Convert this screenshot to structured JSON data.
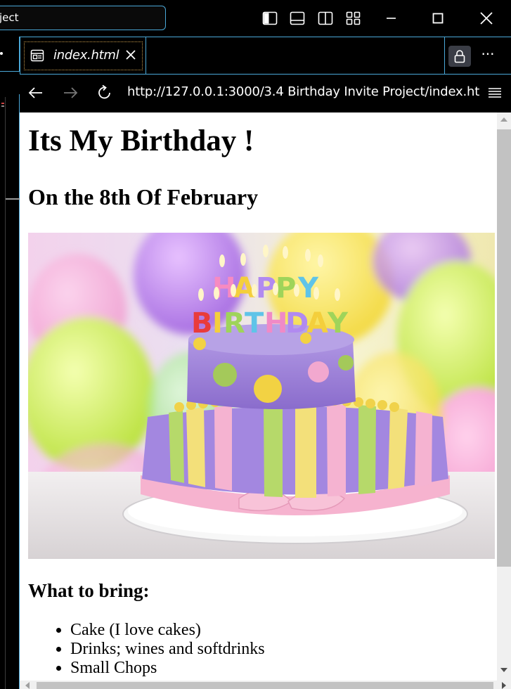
{
  "titlebar": {
    "search_text": "ject",
    "icons": [
      "toggle-primary-sidebar-icon",
      "toggle-panel-icon",
      "toggle-secondary-sidebar-icon",
      "customize-layout-icon"
    ],
    "window_controls": [
      "minimize-icon",
      "maximize-icon",
      "close-icon"
    ]
  },
  "tabbar": {
    "active_tab": {
      "label": "index.html",
      "icon": "preview-icon",
      "close": "close-icon"
    },
    "actions": [
      "lock-icon",
      "more-actions-icon"
    ]
  },
  "browser": {
    "url": "http://127.0.0.1:3000/3.4 Birthday Invite Project/index.ht",
    "nav": [
      "back-arrow-icon",
      "forward-arrow-icon",
      "reload-icon",
      "hamburger-menu-icon"
    ]
  },
  "page": {
    "title": "Its My Birthday !",
    "subtitle": "On the 8th Of February",
    "image_alt": "birthday cake",
    "bring_title": "What to bring:",
    "bring_items": [
      "Cake (I love cakes)",
      "Drinks; wines and softdrinks",
      "Small Chops"
    ]
  },
  "colors": {
    "accent": "#4aa8d8",
    "page_bg": "#ffffff",
    "chrome_bg": "#000000"
  }
}
